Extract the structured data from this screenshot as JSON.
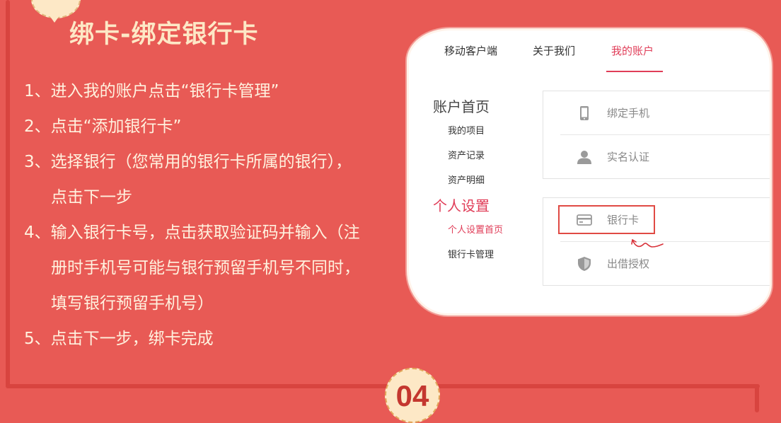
{
  "title": "绑卡-绑定银行卡",
  "steps": [
    [
      "1、进入我的账户点击“银行卡管理”"
    ],
    [
      "2、点击“添加银行卡”"
    ],
    [
      "3、选择银行（您常用的银行卡所属的银行），",
      "点击下一步"
    ],
    [
      "4、输入银行卡号，点击获取验证码并输入（注",
      "册时手机号可能与银行预留手机号不同时，",
      "填写银行预留手机号）"
    ],
    [
      "5、点击下一步，绑卡完成"
    ]
  ],
  "screenshot": {
    "tabs": [
      "移动客户端",
      "关于我们",
      "我的账户"
    ],
    "active_tab": "我的账户",
    "sidebar": {
      "account_heading": "账户首页",
      "account_items": [
        "我的项目",
        "资产记录",
        "资产明细"
      ],
      "settings_heading": "个人设置",
      "settings_items": [
        "个人设置首页",
        "银行卡管理"
      ]
    },
    "security_box": [
      "绑定手机",
      "实名认证"
    ],
    "binding_box": [
      "银行卡",
      "出借授权"
    ],
    "highlighted": "银行卡"
  },
  "section_number": "04",
  "colors": {
    "background": "#e85a55",
    "title": "#fde8c6",
    "accent": "#e03d58",
    "highlight": "#e04a44"
  },
  "icons": [
    "phone-icon",
    "user-icon",
    "card-icon",
    "shield-icon"
  ]
}
